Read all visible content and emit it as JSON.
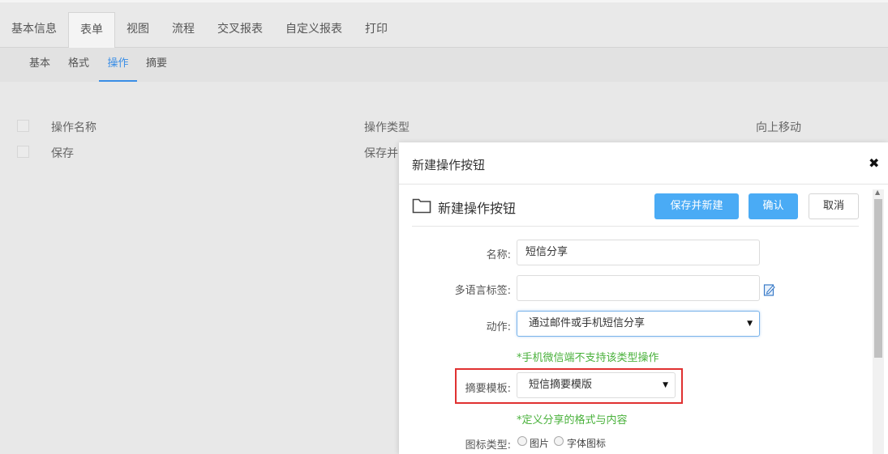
{
  "top_tabs": [
    "基本信息",
    "表单",
    "视图",
    "流程",
    "交叉报表",
    "自定义报表",
    "打印"
  ],
  "top_tab_active": "表单",
  "sub_tabs": [
    "基本",
    "格式",
    "操作",
    "摘要"
  ],
  "sub_tab_active": "操作",
  "table": {
    "headers": [
      "操作名称",
      "操作类型",
      "向上移动"
    ],
    "rows": [
      {
        "name": "保存",
        "type": "保存并"
      }
    ]
  },
  "modal": {
    "title": "新建操作按钮",
    "close_icon": "close-icon",
    "section_title": "新建操作按钮",
    "buttons": {
      "save_new": "保存并新建",
      "confirm": "确认",
      "cancel": "取消"
    },
    "form": {
      "name_label": "名称:",
      "name_value": "短信分享",
      "i18n_label": "多语言标签:",
      "i18n_value": "",
      "action_label": "动作:",
      "action_value": "通过邮件或手机短信分享",
      "action_hint": "*手机微信端不支持该类型操作",
      "template_label": "摘要模板:",
      "template_value": "短信摘要模版",
      "template_hint": "*定义分享的格式与内容",
      "icon_type_label": "图标类型:",
      "icon_type_options": [
        "图片",
        "字体图标"
      ]
    }
  },
  "colors": {
    "primary": "#4aabf5",
    "hint_green": "#49b13b",
    "highlight_red": "#e03131",
    "active_tab_blue": "#3a8ee6"
  }
}
